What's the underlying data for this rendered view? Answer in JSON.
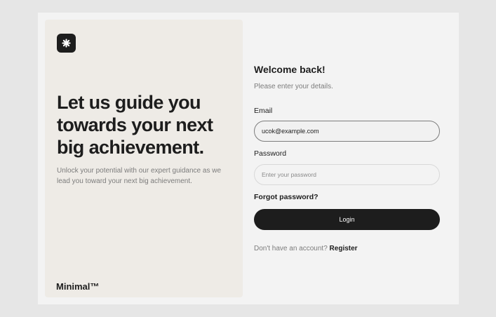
{
  "hero": {
    "logo_icon": "asterisk-icon",
    "headline": "Let us guide you towards your next big achievement.",
    "subtext": "Unlock your potential with our expert guidance as we lead you toward your next big achievement.",
    "brand": "Minimal™"
  },
  "form": {
    "title": "Welcome back!",
    "subtitle": "Please enter your details.",
    "email_label": "Email",
    "email_value": "ucok@example.com",
    "password_label": "Password",
    "password_placeholder": "Enter your password",
    "forgot_label": "Forgot password?",
    "login_label": "Login",
    "register_prompt": "Don't have an account?",
    "register_label": "Register"
  },
  "colors": {
    "page_bg": "#e6e6e6",
    "card_bg": "#f3f3f3",
    "hero_bg": "#eeebe6",
    "primary": "#1d1d1d",
    "muted_text": "#7c7c7c"
  }
}
